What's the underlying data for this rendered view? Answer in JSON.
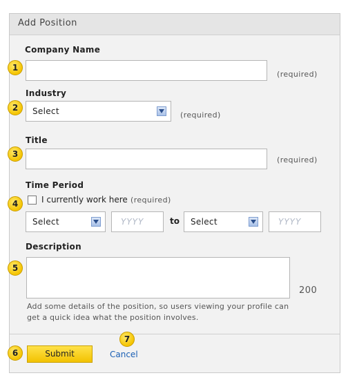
{
  "form": {
    "title": "Add Position",
    "required_text": "(required)",
    "company": {
      "label": "Company Name",
      "value": ""
    },
    "industry": {
      "label": "Industry",
      "selected": "Select"
    },
    "title_field": {
      "label": "Title",
      "value": ""
    },
    "time_period": {
      "label": "Time Period",
      "current_label": "I currently work here",
      "current_checked": false,
      "start_month": "Select",
      "start_year_placeholder": "YYYY",
      "to_label": "to",
      "end_month": "Select",
      "end_year_placeholder": "YYYY"
    },
    "description": {
      "label": "Description",
      "value": "",
      "counter": "200",
      "help": "Add some details of the position, so users viewing your profile can get a quick idea what the position involves."
    },
    "actions": {
      "submit": "Submit",
      "cancel": "Cancel"
    }
  },
  "badges": [
    "1",
    "2",
    "3",
    "4",
    "5",
    "6",
    "7"
  ],
  "colors": {
    "badge": "#f5c400",
    "link": "#1a5fb4",
    "submit": "#f2c200"
  }
}
